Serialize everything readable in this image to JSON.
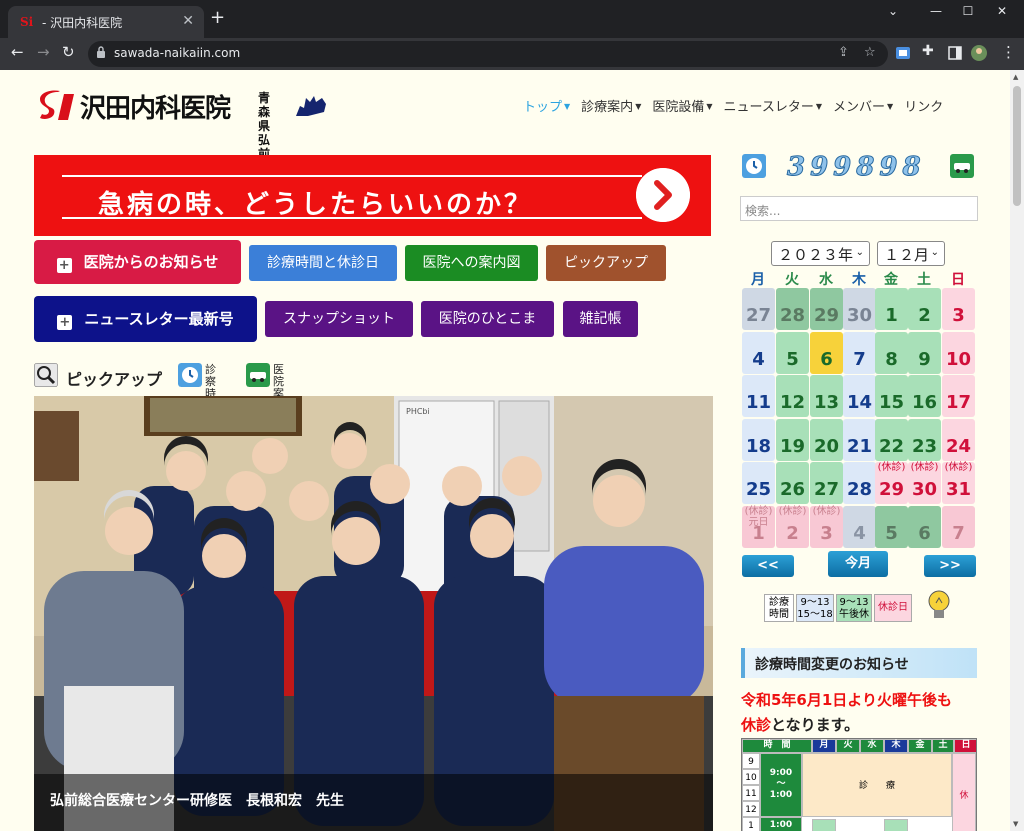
{
  "browser": {
    "tab_title": "- 沢田内科医院",
    "tab_favicon": "Si",
    "url": "sawada-naikaiin.com",
    "new_tab": "+",
    "close_tab": "✕"
  },
  "site": {
    "logo_text": "沢田内科医院",
    "logo_pref_line1": "青森県",
    "logo_pref_line2": "弘前市"
  },
  "nav": {
    "items": [
      {
        "label": "トップ",
        "dropdown": true,
        "active": true
      },
      {
        "label": "診療案内",
        "dropdown": true
      },
      {
        "label": "医院設備",
        "dropdown": true
      },
      {
        "label": "ニュースレター",
        "dropdown": true
      },
      {
        "label": "メンバー",
        "dropdown": true
      },
      {
        "label": "リンク",
        "dropdown": false
      }
    ]
  },
  "banner": {
    "text": "急病の時、どうしたらいいのか？"
  },
  "buttons": {
    "notice": "医院からのお知らせ",
    "hours": "診療時間と休診日",
    "map": "医院への案内図",
    "pickup": "ピックアップ",
    "newsletter": "ニュースレター最新号",
    "snapshot": "スナップショット",
    "hitokoma": "医院のひとこま",
    "notes": "雑記帳"
  },
  "pickup_section": {
    "title": "ピックアップ",
    "hours_label_1": "診察",
    "hours_label_2": "時間",
    "guide_label_1": "医院",
    "guide_label_2": "案内"
  },
  "photo": {
    "caption": "弘前総合医療センター研修医　長根和宏　先生",
    "fridge_label": "PHCbi"
  },
  "counter": {
    "value": "399898"
  },
  "search": {
    "placeholder": "検索..."
  },
  "calendar": {
    "year": "２０２３年",
    "month": "１２月",
    "weekdays": [
      "月",
      "火",
      "水",
      "木",
      "金",
      "土",
      "日"
    ],
    "weekday_colors": [
      "#1a5fa8",
      "#2a8a4a",
      "#2a8a4a",
      "#1a5fa8",
      "#2a8a4a",
      "#2a8a4a",
      "#d0103a"
    ],
    "weeks": [
      [
        {
          "d": "27",
          "s": "out-grey"
        },
        {
          "d": "28",
          "s": "out-green"
        },
        {
          "d": "29",
          "s": "out-green"
        },
        {
          "d": "30",
          "s": "out-grey"
        },
        {
          "d": "1",
          "s": "green"
        },
        {
          "d": "2",
          "s": "green"
        },
        {
          "d": "3",
          "s": "pink"
        }
      ],
      [
        {
          "d": "4",
          "s": "blue"
        },
        {
          "d": "5",
          "s": "green"
        },
        {
          "d": "6",
          "s": "today"
        },
        {
          "d": "7",
          "s": "blue"
        },
        {
          "d": "8",
          "s": "green"
        },
        {
          "d": "9",
          "s": "green"
        },
        {
          "d": "10",
          "s": "pink"
        }
      ],
      [
        {
          "d": "11",
          "s": "blue"
        },
        {
          "d": "12",
          "s": "green"
        },
        {
          "d": "13",
          "s": "green"
        },
        {
          "d": "14",
          "s": "blue"
        },
        {
          "d": "15",
          "s": "green"
        },
        {
          "d": "16",
          "s": "green"
        },
        {
          "d": "17",
          "s": "pink"
        }
      ],
      [
        {
          "d": "18",
          "s": "blue"
        },
        {
          "d": "19",
          "s": "green"
        },
        {
          "d": "20",
          "s": "green"
        },
        {
          "d": "21",
          "s": "blue"
        },
        {
          "d": "22",
          "s": "green"
        },
        {
          "d": "23",
          "s": "green"
        },
        {
          "d": "24",
          "s": "pink"
        }
      ],
      [
        {
          "d": "25",
          "s": "blue"
        },
        {
          "d": "26",
          "s": "green"
        },
        {
          "d": "27",
          "s": "green"
        },
        {
          "d": "28",
          "s": "blue"
        },
        {
          "d": "29",
          "s": "pink",
          "n": "(休診)"
        },
        {
          "d": "30",
          "s": "pink",
          "n": "(休診)"
        },
        {
          "d": "31",
          "s": "pink",
          "n": "(休診)"
        }
      ],
      [
        {
          "d": "1",
          "s": "out-pink",
          "n": "(休診)\n元日"
        },
        {
          "d": "2",
          "s": "out-pink",
          "n": "(休診)"
        },
        {
          "d": "3",
          "s": "out-pink",
          "n": "(休診)"
        },
        {
          "d": "4",
          "s": "out-blue"
        },
        {
          "d": "5",
          "s": "out-green"
        },
        {
          "d": "6",
          "s": "out-green"
        },
        {
          "d": "7",
          "s": "out-pink"
        }
      ]
    ],
    "prev": "<<",
    "today": "今月",
    "next": ">>"
  },
  "legend": {
    "label": "診療\n時間",
    "weekday_hours": "9～13\n15～18",
    "afternoon_off": "9～13\n午後休",
    "closed": "休診日"
  },
  "notice": {
    "heading": "診療時間変更のお知らせ",
    "line1": "令和5年6月1日より火曜午後も",
    "line2_red": "休診",
    "line2_rest": "となります。"
  },
  "schedule": {
    "header": [
      "時　間",
      "月",
      "火",
      "水",
      "木",
      "金",
      "土",
      "日"
    ],
    "hours": [
      "9",
      "10",
      "11",
      "12",
      "1"
    ],
    "morning_time": "9:00\n～\n1:00",
    "afternoon_time": "1:00",
    "morning_label": "診　　療",
    "closed_label": "休"
  },
  "colors": {
    "banner_red": "#ee1111",
    "notice_btn": "#d81b45",
    "hours_btn": "#3b7fd8",
    "map_btn": "#1b8c23",
    "pickup_btn": "#a0522d",
    "newsletter_btn": "#0d128a",
    "purple_btn": "#5a1385",
    "nav_active": "#2ba3e0"
  }
}
